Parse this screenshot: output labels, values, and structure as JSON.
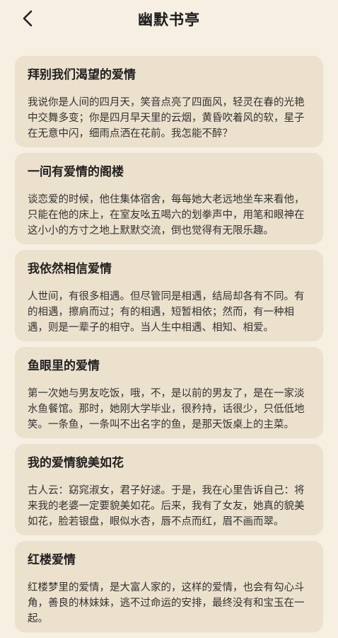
{
  "header": {
    "title": "幽默书亭",
    "back_icon": "chevron-left-icon"
  },
  "colors": {
    "background": "#f6efe2",
    "card": "#ece1cc"
  },
  "articles": [
    {
      "title": "拜别我们渴望的爱情",
      "excerpt": "我说你是人间的四月天，笑音点亮了四面风，轻灵在春的光艳中交舞多变；你是四月早天里的云烟，黄昏吹着风的软，星子在无意中闪，细雨点洒在花前。我怎能不醉？"
    },
    {
      "title": "一间有爱情的阁楼",
      "excerpt": "谈恋爱的时候，他住集体宿舍，每每她大老远地坐车来看他，只能在他的床上，在室友吆五喝六的划拳声中，用笔和眼神在这小小的方寸之地上默默交流，倒也觉得有无限乐趣。"
    },
    {
      "title": "我依然相信爱情",
      "excerpt": "人世间，有很多相遇。但尽管同是相遇，结局却各有不同。有的相遇，擦肩而过；有的相遇，短暂相依；然而，有一种相遇，则是一辈子的相守。当人生中相遇、相知、相爱。"
    },
    {
      "title": "鱼眼里的爱情",
      "excerpt": "第一次她与男友吃饭，哦，不，是以前的男友了，是在一家淡水鱼餐馆。那时，她刚大学毕业，很矜持，话很少，只低低地笑。一条鱼，一条叫不出名字的鱼，是那天饭桌上的主菜。"
    },
    {
      "title": "我的爱情貌美如花",
      "excerpt": "古人云：窈窕淑女，君子好逑。于是，我在心里告诉自己：将来我的老婆一定要貌美如花。后来，我有了女友，她真的貌美如花，脸若银盘，眼似水杏，唇不点而红，眉不画而翠。"
    },
    {
      "title": "红楼爱情",
      "excerpt": "红楼梦里的爱情，是大富人家的，这样的爱情，也会有勾心斗角，善良的林妹妹，逃不过命运的安排，最终没有和宝玉在一起。"
    }
  ]
}
